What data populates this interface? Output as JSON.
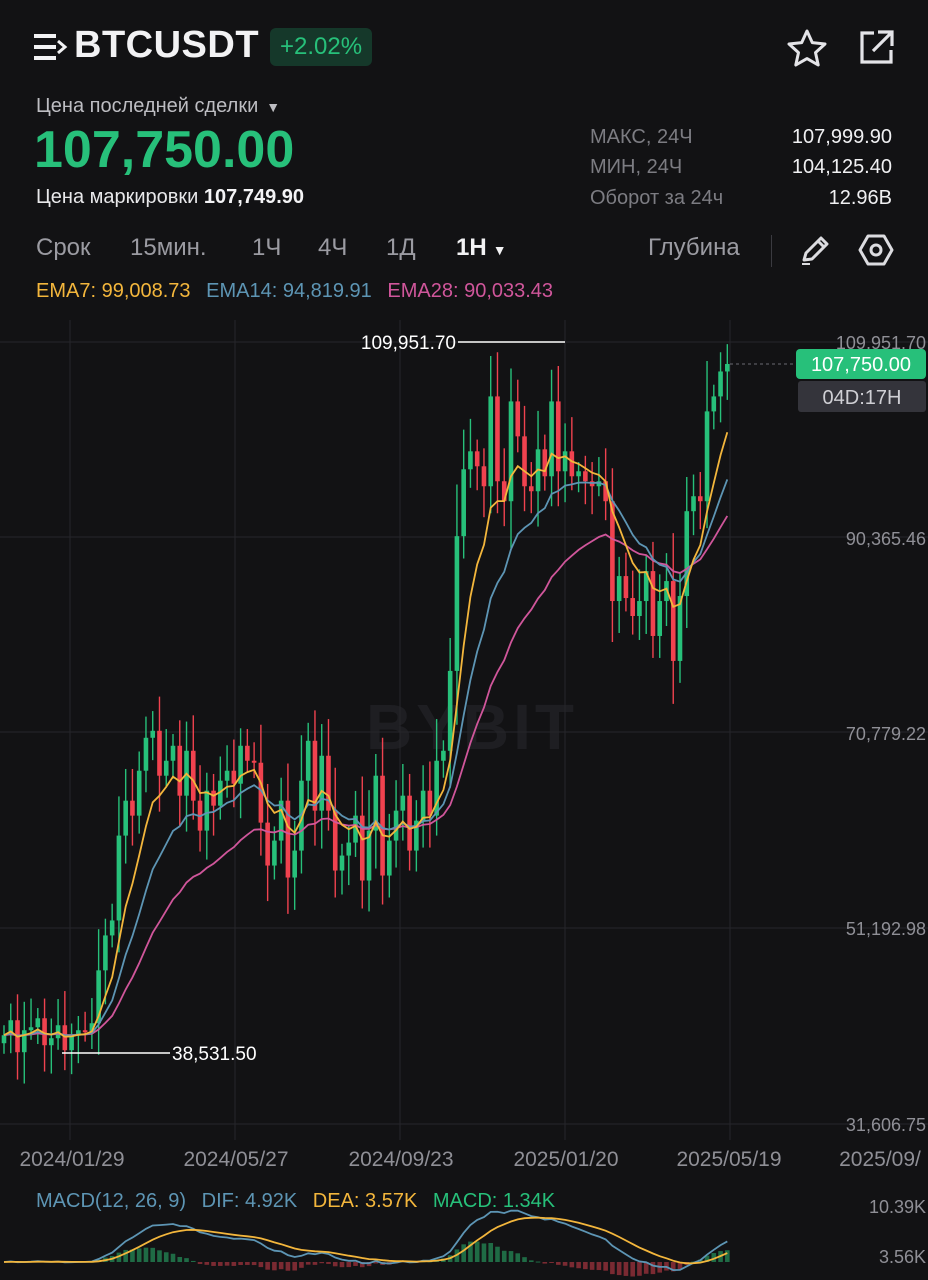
{
  "header": {
    "symbol": "BTCUSDT",
    "change_pct": "+2.02%",
    "icons": [
      "menu-icon",
      "star-icon",
      "share-icon"
    ]
  },
  "price": {
    "type_label": "Цена последней сделки",
    "last": "107,750.00",
    "mark_label": "Цена маркировки",
    "mark_value": "107,749.90"
  },
  "stats": [
    {
      "label": "МАКС, 24Ч",
      "value": "107,999.90"
    },
    {
      "label": "МИН, 24Ч",
      "value": "104,125.40"
    },
    {
      "label": "Оборот за 24ч",
      "value": "12.96B"
    }
  ],
  "timeframes": {
    "term_label": "Срок",
    "items": [
      "15мин.",
      "1Ч",
      "4Ч",
      "1Д"
    ],
    "active": "1Н",
    "depth_label": "Глубина",
    "icons": [
      "pencil-icon",
      "settings-icon"
    ]
  },
  "ema": {
    "ema7": "EMA7: 99,008.73",
    "ema14": "EMA14: 94,819.91",
    "ema28": "EMA28: 90,033.43"
  },
  "macd": {
    "title": "MACD(12, 26, 9)",
    "dif": "DIF: 4.92K",
    "dea": "DEA: 3.57K",
    "macd": "MACD: 1.34K",
    "ticks": [
      "10.39K",
      "3.56K"
    ]
  },
  "watermark": "BYBIT",
  "colors": {
    "up": "#27c07a",
    "down": "#f0424f",
    "ema7": "#f3b63c",
    "ema14": "#5d95b4",
    "ema28": "#d0569b",
    "background": "#121214"
  },
  "chart_data": {
    "type": "candlestick",
    "interval": "1W",
    "y_ticks": [
      "109,951.70",
      "90,365.46",
      "70,779.22",
      "51,192.98",
      "31,606.75"
    ],
    "x_ticks": [
      "2024/01/29",
      "2024/05/27",
      "2024/09/23",
      "2025/01/20",
      "2025/05/19",
      "2025/09/"
    ],
    "ylim": [
      31606.75,
      109951.7
    ],
    "high_label": "109,951.70",
    "low_label": "38,531.50",
    "last_price_tag": "107,750.00",
    "countdown": "04D:17H",
    "closes": [
      40500,
      42000,
      38800,
      41000,
      41300,
      42200,
      39500,
      40200,
      41500,
      39000,
      40500,
      41000,
      40800,
      41700,
      47000,
      50500,
      52000,
      60500,
      64000,
      62500,
      67000,
      70300,
      71000,
      66500,
      68000,
      69500,
      64500,
      69000,
      64000,
      61000,
      65000,
      63500,
      66000,
      67000,
      65700,
      69500,
      68000,
      67800,
      61800,
      57500,
      60000,
      64000,
      56300,
      59000,
      66000,
      70000,
      63000,
      68500,
      63000,
      57000,
      58500,
      59800,
      62500,
      56000,
      61000,
      66500,
      56500,
      60000,
      63000,
      64500,
      59000,
      62000,
      65000,
      62500,
      68000,
      69000,
      77000,
      90500,
      97200,
      99000,
      97500,
      95500,
      104500,
      96000,
      94000,
      104000,
      100500,
      95500,
      95000,
      99200,
      96500,
      104000,
      97000,
      99000,
      96500,
      97000,
      96000,
      95500,
      96000,
      94000,
      84000,
      86500,
      84300,
      82500,
      84000,
      87000,
      80500,
      84000,
      86000,
      78000,
      84500,
      93000,
      94500,
      94000,
      103000,
      104500,
      107000,
      107750
    ],
    "ema7_end": 99008.73,
    "ema14_end": 94819.91,
    "ema28_end": 90033.43
  }
}
